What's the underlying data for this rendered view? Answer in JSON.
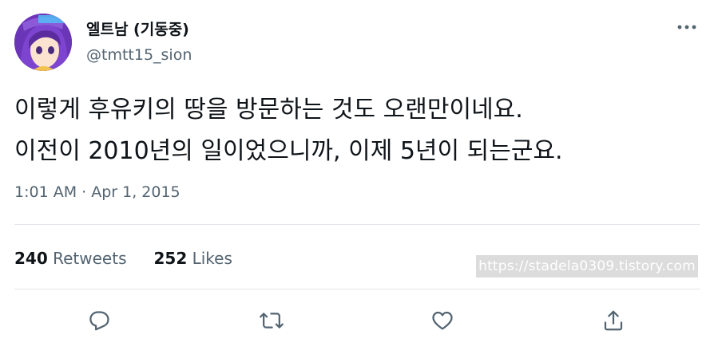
{
  "tweet": {
    "display_name": "엘트남 (기동중)",
    "handle": "@tmtt15_sion",
    "text_lines": [
      "이렇게 후유키의 땅을 방문하는 것도 오랜만이네요.",
      "이전이 2010년의 일이었으니까, 이제 5년이 되는군요."
    ],
    "timestamp": "1:01 AM · Apr 1, 2015",
    "retweets_count": "240",
    "retweets_label": "Retweets",
    "likes_count": "252",
    "likes_label": "Likes"
  },
  "watermark": "https://stadela0309.tistory.com",
  "icons": {
    "more": "more-horizontal-icon",
    "reply": "reply-icon",
    "retweet": "retweet-icon",
    "like": "heart-icon",
    "share": "share-icon"
  },
  "colors": {
    "primary_text": "#0f1419",
    "secondary_text": "#536471",
    "divider": "#e1e6ea"
  }
}
